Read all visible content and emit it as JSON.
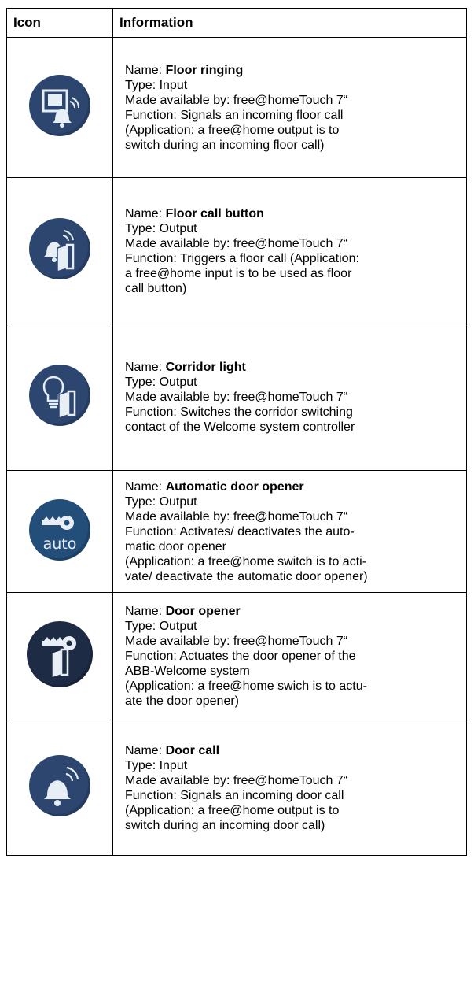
{
  "table": {
    "header_icon": "Icon",
    "header_info": "Information"
  },
  "rows": [
    {
      "icon": "floor-ringing-icon",
      "name_prefix": "Name: ",
      "name": "Floor ringing",
      "type": "Type: Input",
      "made": "Made available by: free@homeTouch 7“",
      "lines": [
        "Function: Signals an incoming floor call",
        "(Application: a free@home output is to",
        "switch during an incoming floor call)"
      ]
    },
    {
      "icon": "floor-call-button-icon",
      "name_prefix": "Name: ",
      "name": "Floor call button",
      "type": "Type: Output",
      "made": "Made available by: free@homeTouch 7“",
      "lines": [
        "Function: Triggers a floor call (Application:",
        "a free@home input is to be used as floor",
        "call button)"
      ]
    },
    {
      "icon": "corridor-light-icon",
      "name_prefix": "Name: ",
      "name": "Corridor light",
      "type": "Type: Output",
      "made": "Made available by: free@homeTouch 7“",
      "lines": [
        "Function: Switches the corridor switching",
        "contact of the Welcome system controller"
      ]
    },
    {
      "icon": "automatic-door-opener-icon",
      "icon_text": "auto",
      "name_prefix": "Name: ",
      "name": "Automatic door opener",
      "type": "Type: Output",
      "made": "Made available by: free@homeTouch 7“",
      "lines": [
        "Function: Activates/ deactivates the auto-",
        "matic door opener",
        "(Application: a free@home switch is to acti-",
        "vate/ deactivate the automatic door opener)"
      ]
    },
    {
      "icon": "door-opener-icon",
      "name_prefix": "Name: ",
      "name": "Door opener",
      "type": "Type: Output",
      "made": "Made available by: free@homeTouch 7“",
      "lines": [
        "Function: Actuates the door opener of the",
        "ABB-Welcome system",
        "(Application: a free@home swich is to actu-",
        "ate the door opener)"
      ]
    },
    {
      "icon": "door-call-icon",
      "name_prefix": "Name: ",
      "name": "Door call",
      "type": "Type: Input",
      "made": "Made available by: free@homeTouch 7“",
      "lines": [
        "Function: Signals an incoming door call",
        "(Application: a free@home output is to",
        "switch during an incoming door call)"
      ]
    }
  ],
  "colors": {
    "icon_bg": "#2c4670",
    "icon_fg": "#e8eef5",
    "door_opener_bg": "#1d2b45"
  }
}
